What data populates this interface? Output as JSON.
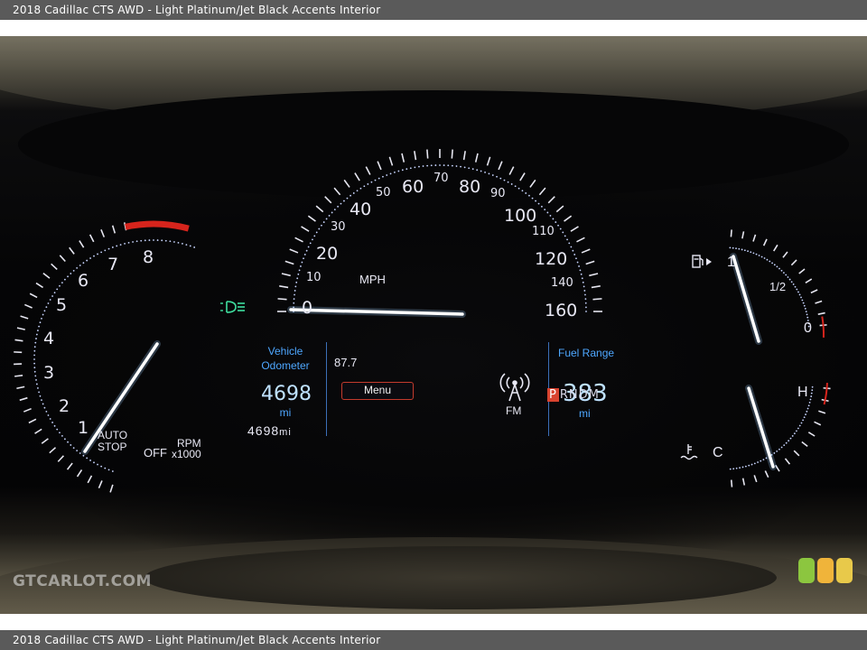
{
  "caption": "2018 Cadillac CTS AWD - Light Platinum/Jet Black Accents Interior",
  "tachometer": {
    "numbers": [
      "1",
      "2",
      "3",
      "4",
      "5",
      "6",
      "7",
      "8"
    ],
    "auto_stop": "AUTO\nSTOP",
    "off": "OFF",
    "rpm_unit": "RPM",
    "rpm_mult": "x1000"
  },
  "speedometer": {
    "big_numbers": [
      "0",
      "20",
      "40",
      "60",
      "80",
      "100",
      "120",
      "160"
    ],
    "small_numbers": [
      "10",
      "30",
      "50",
      "70",
      "90",
      "110",
      "140"
    ],
    "unit": "MPH"
  },
  "info": {
    "odometer_label": "Vehicle\nOdometer",
    "odometer_value": "4698",
    "odometer_unit": "mi",
    "odometer_bottom": "4698",
    "odometer_bottom_unit": "mi",
    "radio_freq": "87.7",
    "menu_label": "Menu",
    "radio_band": "FM",
    "fuel_range_label": "Fuel Range",
    "fuel_range_value": "383",
    "fuel_range_unit": "mi",
    "gear_selected": "P",
    "gears_rest": "RNDM"
  },
  "fuel_gauge": {
    "full": "1",
    "half": "1/2",
    "empty": "0"
  },
  "temp_gauge": {
    "hot": "H",
    "cold": "C"
  },
  "watermark": {
    "text": "GTCARLOT.COM"
  },
  "colors": {
    "gauge_blue": "#4ea7ff",
    "needle_white": "#ffffff",
    "redline": "#d6241c",
    "lights_green": "#3fe0a0"
  }
}
